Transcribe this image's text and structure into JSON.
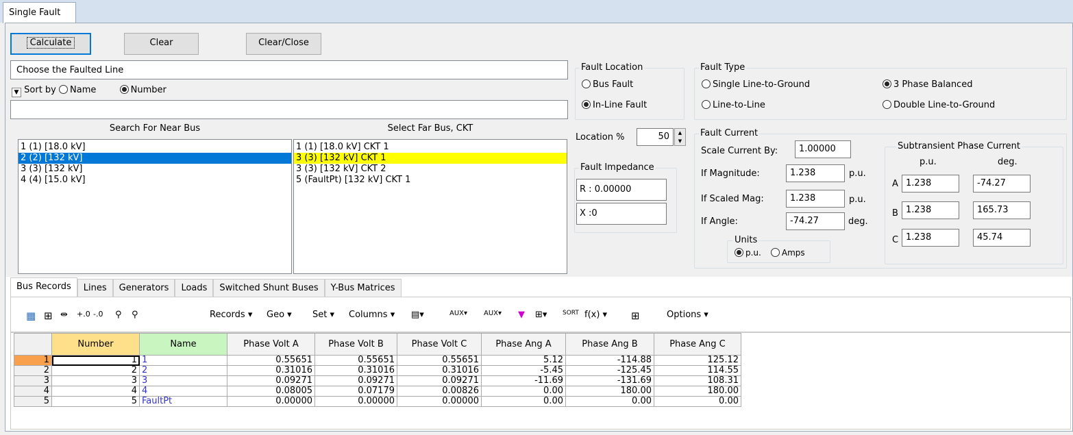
{
  "window_tab": "Single Fault",
  "buttons": {
    "calculate": "Calculate",
    "clear": "Clear",
    "clear_close": "Clear/Close"
  },
  "faulted_line": {
    "title": "Choose the Faulted Line",
    "sort_by": "Sort by",
    "sort_name": "Name",
    "sort_number": "Number",
    "filter_value": "",
    "near_header": "Search For Near Bus",
    "far_header": "Select Far Bus, CKT",
    "near_items": [
      "1 (1)  [18.0 kV]",
      "2 (2)  [132 kV]",
      "3 (3)  [132 kV]",
      "4 (4)  [15.0 kV]"
    ],
    "far_items": [
      "1 (1) [18.0 kV] CKT  1",
      "3 (3) [132 kV] CKT  1",
      "3 (3) [132 kV] CKT  2",
      "5 (FaultPt) [132 kV] CKT  1"
    ]
  },
  "fault_location": {
    "title": "Fault Location",
    "bus_fault": "Bus Fault",
    "inline_fault": "In-Line Fault",
    "selected": "inline"
  },
  "location_pct": {
    "label": "Location %",
    "value": "50"
  },
  "fault_impedance": {
    "title": "Fault Impedance",
    "r_label": "R :",
    "r_value": "0.00000",
    "x_label": "X :",
    "x_value": "0"
  },
  "fault_type": {
    "title": "Fault Type",
    "slg": "Single Line-to-Ground",
    "ll": "Line-to-Line",
    "three_phase": "3 Phase Balanced",
    "dlg": "Double Line-to-Ground",
    "selected": "three_phase"
  },
  "fault_current": {
    "title": "Fault Current",
    "scale_label": "Scale Current By:",
    "scale_value": "1.00000",
    "mag_label": "If Magnitude:",
    "mag_value": "1.238",
    "mag_unit": "p.u.",
    "scaled_label": "If Scaled Mag:",
    "scaled_value": "1.238",
    "scaled_unit": "p.u.",
    "angle_label": "If Angle:",
    "angle_value": "-74.27",
    "angle_unit": "deg.",
    "units_title": "Units",
    "units_pu": "p.u.",
    "units_amps": "Amps",
    "units_selected": "pu"
  },
  "subtransient": {
    "title": "Subtransient Phase Current",
    "col_pu": "p.u.",
    "col_deg": "deg.",
    "phases": [
      {
        "label": "A",
        "pu": "1.238",
        "deg": "-74.27"
      },
      {
        "label": "B",
        "pu": "1.238",
        "deg": "165.73"
      },
      {
        "label": "C",
        "pu": "1.238",
        "deg": "45.74"
      }
    ]
  },
  "record_tabs": [
    "Bus Records",
    "Lines",
    "Generators",
    "Loads",
    "Switched Shunt Buses",
    "Y-Bus Matrices"
  ],
  "toolbar": {
    "records": "Records ▾",
    "geo": "Geo ▾",
    "set": "Set ▾",
    "columns": "Columns ▾",
    "fx": "f(x) ▾",
    "options": "Options ▾"
  },
  "table": {
    "headers": [
      "Number",
      "Name",
      "Phase Volt A",
      "Phase Volt B",
      "Phase Volt C",
      "Phase Ang A",
      "Phase Ang B",
      "Phase Ang C"
    ],
    "rows": [
      [
        "1",
        "1",
        "1",
        "0.55651",
        "0.55651",
        "0.55651",
        "5.12",
        "-114.88",
        "125.12"
      ],
      [
        "2",
        "2",
        "2",
        "0.31016",
        "0.31016",
        "0.31016",
        "-5.45",
        "-125.45",
        "114.55"
      ],
      [
        "3",
        "3",
        "3",
        "0.09271",
        "0.09271",
        "0.09271",
        "-11.69",
        "-131.69",
        "108.31"
      ],
      [
        "4",
        "4",
        "4",
        "0.08005",
        "0.07179",
        "0.00826",
        "0.00",
        "180.00",
        "180.00"
      ],
      [
        "5",
        "5",
        "FaultPt",
        "0.00000",
        "0.00000",
        "0.00000",
        "0.00",
        "0.00",
        "0.00"
      ]
    ]
  },
  "colors": {
    "accent": "#0078d7",
    "highlight": "#ffff00",
    "number_header": "#ffe08a",
    "name_header": "#c8f5c0"
  }
}
